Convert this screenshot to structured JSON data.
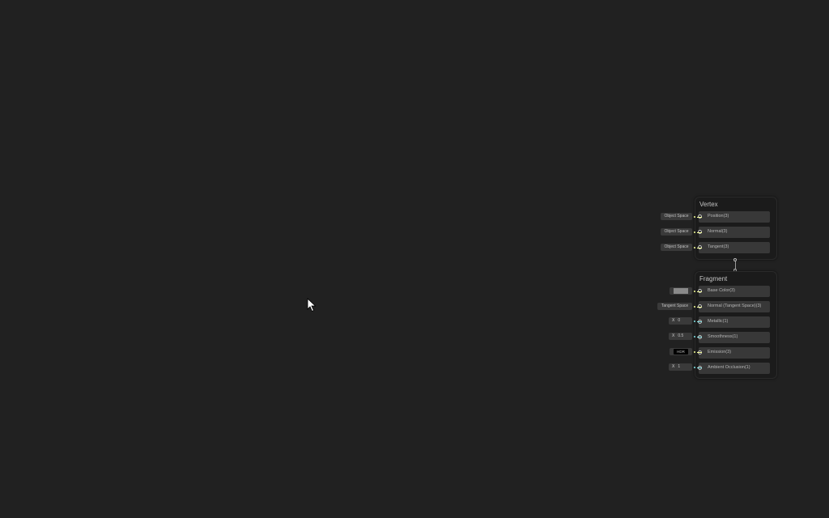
{
  "colors": {
    "background": "#212121",
    "wire_vector3": "#f6ff9a",
    "wire_vector1": "#84e4e7"
  },
  "vertex": {
    "title": "Vertex",
    "blocks": [
      {
        "label": "Position(3)",
        "input": "Object Space"
      },
      {
        "label": "Normal(3)",
        "input": "Object Space"
      },
      {
        "label": "Tangent(3)",
        "input": "Object Space"
      }
    ]
  },
  "fragment": {
    "title": "Fragment",
    "blocks": [
      {
        "label": "Base Color(3)",
        "input_type": "color"
      },
      {
        "label": "Normal (Tangent Space)(3)",
        "input": "Tangent Space"
      },
      {
        "label": "Metallic(1)",
        "axis": "X",
        "value": "0"
      },
      {
        "label": "Smoothness(1)",
        "axis": "X",
        "value": "0.5"
      },
      {
        "label": "Emission(3)",
        "input": "HDR"
      },
      {
        "label": "Ambient Occlusion(1)",
        "axis": "X",
        "value": "1"
      }
    ]
  },
  "icons": {
    "cursor": "mouse-pointer-icon",
    "port": "port-circle-icon"
  }
}
